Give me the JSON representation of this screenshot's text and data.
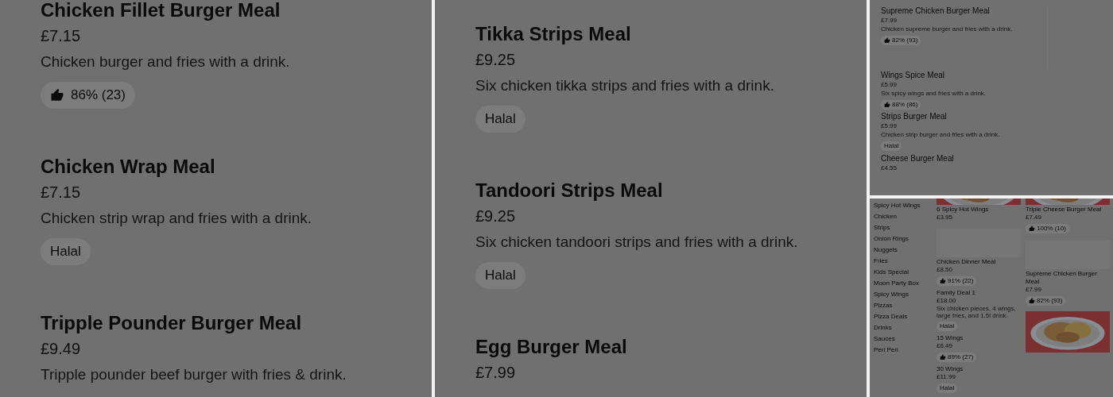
{
  "panels": [
    {
      "items": [
        {
          "name": "Chicken Fillet Burger Meal",
          "price": "£7.15",
          "description": "Chicken burger and fries with a drink.",
          "badge": {
            "kind": "rating",
            "text": "86% (23)"
          }
        },
        {
          "name": "Chicken Wrap Meal",
          "price": "£7.15",
          "description": "Chicken strip wrap and fries with a drink.",
          "badge": {
            "kind": "tag",
            "text": "Halal"
          }
        },
        {
          "name": "Tripple Pounder Burger Meal",
          "price": "£9.49",
          "description": "Tripple pounder beef burger with fries & drink."
        }
      ]
    },
    {
      "items": [
        {
          "name": "Tikka Strips Meal",
          "price": "£9.25",
          "description": "Six chicken tikka strips and fries with a drink.",
          "badge": {
            "kind": "tag",
            "text": "Halal"
          }
        },
        {
          "name": "Tandoori Strips Meal",
          "price": "£9.25",
          "description": "Six chicken tandoori strips and fries with a drink.",
          "badge": {
            "kind": "tag",
            "text": "Halal"
          }
        },
        {
          "name": "Egg Burger Meal",
          "price": "£7.99"
        }
      ]
    }
  ],
  "small_list": {
    "items": [
      {
        "name": "Supreme Chicken Burger Meal",
        "price": "£7.99",
        "description": "Chicken supreme burger and fries with a drink.",
        "badge": {
          "kind": "rating",
          "text": "82% (93)"
        }
      },
      {
        "name": "Wings Spice Meal",
        "price": "£5.99",
        "description": "Six spicy wings and fries with a drink.",
        "badge": {
          "kind": "rating",
          "text": "88% (86)"
        }
      },
      {
        "name": "Strips Burger Meal",
        "price": "£5.99",
        "description": "Chicken strip burger and fries with a drink.",
        "badge": {
          "kind": "tag",
          "text": "Halal"
        }
      },
      {
        "name": "Cheese Burger Meal",
        "price": "£4.55"
      }
    ]
  },
  "menu_page": {
    "categories": [
      "Spicy Hot Wings",
      "Chicken",
      "Strips",
      "Onion Rings",
      "Nuggets",
      "Fries",
      "Kids Special",
      "Moon Party Box",
      "Spicy Wings",
      "Pizzas",
      "Pizza Deals",
      "Drinks",
      "Sauces",
      "Peri Peri"
    ],
    "columns": [
      [
        {
          "kind": "photo_top",
          "name": "6 Spicy Hot Wings",
          "price": "£3.95"
        },
        {
          "kind": "blank_top",
          "name": "Chicken Dinner Meal",
          "price": "£8.50",
          "badge": {
            "kind": "rating",
            "text": "91% (22)"
          }
        },
        {
          "kind": "text",
          "name": "Family Deal 1",
          "price": "£18.00",
          "description": "Six chicken pieces, 4 wings, large fries, and 1.5l drink.",
          "badge": {
            "kind": "tag",
            "text": "Halal"
          }
        },
        {
          "kind": "text",
          "name": "15 Wings",
          "price": "£6.49",
          "badge": {
            "kind": "rating",
            "text": "89% (27)"
          }
        },
        {
          "kind": "text",
          "name": "30 Wings",
          "price": "£11.99",
          "badge": {
            "kind": "tag",
            "text": "Halal"
          }
        }
      ],
      [
        {
          "kind": "photo_top",
          "name": "Triple Cheese Burger Meal",
          "price": "£7.49",
          "badge": {
            "kind": "rating",
            "text": "100% (10)"
          }
        },
        {
          "kind": "blank_top",
          "name": "Supreme Chicken Burger Meal",
          "price": "£7.99",
          "badge": {
            "kind": "rating",
            "text": "82% (93)"
          }
        },
        {
          "kind": "picture"
        }
      ]
    ]
  }
}
